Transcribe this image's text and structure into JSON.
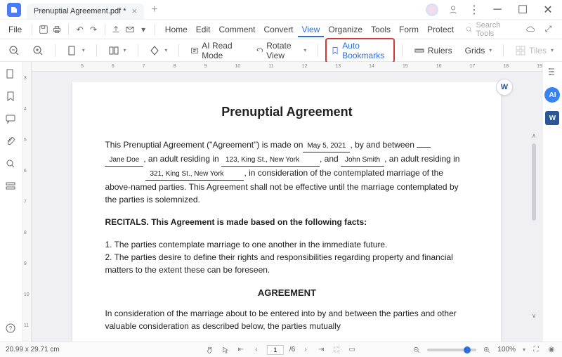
{
  "tab": {
    "title": "Prenuptial Agreement.pdf *"
  },
  "menu": {
    "file": "File",
    "items": [
      "Home",
      "Edit",
      "Comment",
      "Convert",
      "View",
      "Organize",
      "Tools",
      "Form",
      "Protect"
    ],
    "active_index": 4,
    "search_placeholder": "Search Tools"
  },
  "toolbar": {
    "ai_read": "AI Read Mode",
    "rotate": "Rotate View",
    "auto_bookmarks": "Auto Bookmarks",
    "rulers": "Rulers",
    "grids": "Grids",
    "tiles": "Tiles"
  },
  "ruler_h": [
    "5",
    "6",
    "7",
    "8",
    "9",
    "10",
    "11",
    "12",
    "13",
    "14",
    "15",
    "16",
    "17",
    "18",
    "19"
  ],
  "ruler_v": [
    "3",
    "4",
    "5",
    "6",
    "7",
    "8",
    "9",
    "10",
    "11"
  ],
  "document": {
    "title": "Prenuptial Agreement",
    "p1a": "This Prenuptial Agreement (\"Agreement\") is made on",
    "date": "May 5, 2021",
    "p1b": ", by and between ",
    "name1": "Jane Doe",
    "p1c": ", an adult residing in ",
    "addr1": "123, King St., New York",
    "p1d": ", and ",
    "name2": "John Smith",
    "p1e": ", an adult residing in ",
    "addr2": "321, King St., New York",
    "p1f": ", in consideration of the contemplated marriage of the above-named parties. This Agreement shall not be effective until the marriage contemplated by the parties is solemnized.",
    "recitals_head": "RECITALS. This Agreement is made based on the following facts:",
    "recital1": "1. The parties contemplate marriage to one another in the immediate future.",
    "recital2": "2. The parties desire to define their rights and responsibilities regarding property and financial matters to the extent these can be foreseen.",
    "agreement_head": "AGREEMENT",
    "p2": "In consideration of the marriage about to be entered into by and between the parties and other valuable consideration as described below, the parties mutually"
  },
  "status": {
    "dims": "20.99 x 29.71 cm",
    "page_current": "1",
    "page_total": "/6",
    "zoom": "100%"
  },
  "badges": {
    "ai": "AI",
    "word": "W"
  }
}
